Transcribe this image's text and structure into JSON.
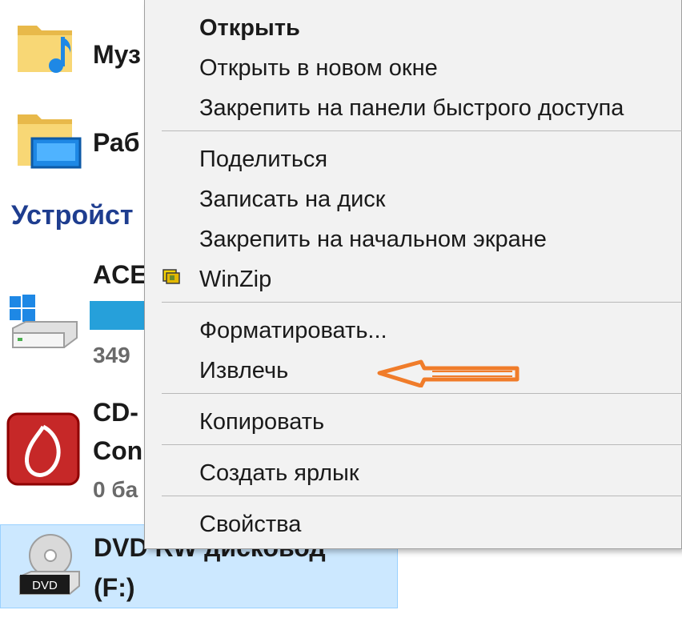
{
  "sidebar": {
    "folders": [
      {
        "label": "Муз",
        "icon": "music-folder-icon"
      },
      {
        "label": "Раб",
        "icon": "desktop-folder-icon"
      }
    ],
    "section_title": "Устройст",
    "devices": [
      {
        "title": "ACE",
        "size_text": "349",
        "icon": "windows-drive-icon"
      },
      {
        "title": "CD-",
        "title2": "Con",
        "size_text": "0 ба",
        "icon": "cd-drive-red-icon"
      },
      {
        "title": "DVD RW дисковод",
        "title2": "(F:)",
        "icon": "dvd-drive-icon",
        "icon_label": "DVD"
      }
    ]
  },
  "context_menu": {
    "items": [
      {
        "label": "Открыть",
        "bold": true
      },
      {
        "label": "Открыть в новом окне"
      },
      {
        "label": "Закрепить на панели быстрого доступа"
      },
      {
        "label": "Поделиться"
      },
      {
        "label": "Записать на диск"
      },
      {
        "label": "Закрепить на начальном экране"
      },
      {
        "label": "WinZip",
        "icon": "winzip-icon"
      },
      {
        "label": "Форматировать..."
      },
      {
        "label": "Извлечь"
      },
      {
        "label": "Копировать"
      },
      {
        "label": "Создать ярлык"
      },
      {
        "label": "Свойства"
      }
    ]
  },
  "colors": {
    "accent_blue": "#26a0da",
    "section_text": "#1e3d8f",
    "selection": "#cce8ff",
    "arrow": "#f07c2a"
  }
}
